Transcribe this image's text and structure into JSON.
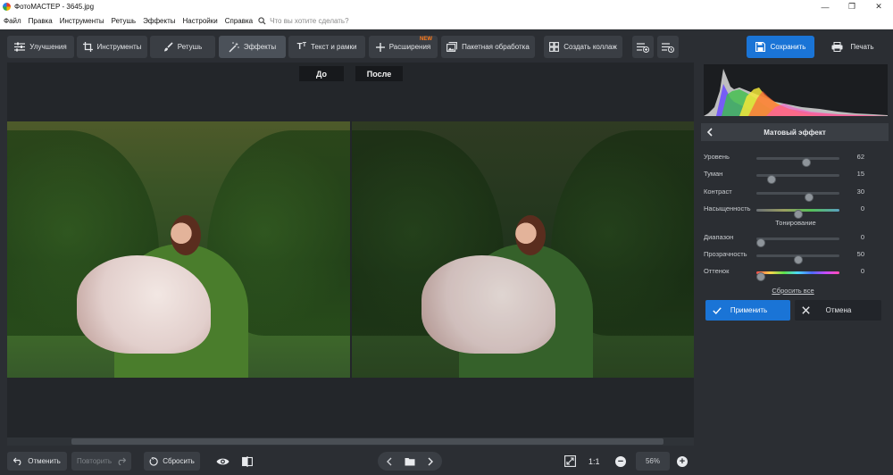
{
  "window": {
    "title": "ФотоМАСТЕР - 3645.jpg"
  },
  "menu": {
    "items": [
      "Файл",
      "Правка",
      "Инструменты",
      "Ретушь",
      "Эффекты",
      "Настройки",
      "Справка"
    ],
    "search_placeholder": "Что вы хотите сделать?"
  },
  "toolbar": {
    "tabs": [
      {
        "label": "Улучшения",
        "icon": "sliders-icon"
      },
      {
        "label": "Инструменты",
        "icon": "crop-icon"
      },
      {
        "label": "Ретушь",
        "icon": "brush-icon"
      },
      {
        "label": "Эффекты",
        "icon": "magic-wand-icon",
        "active": true
      },
      {
        "label": "Текст и рамки",
        "icon": "text-icon"
      },
      {
        "label": "Расширения",
        "icon": "plus-icon",
        "badge": "NEW"
      },
      {
        "label": "Пакетная обработка",
        "icon": "image-stack-icon"
      },
      {
        "label": "Создать коллаж",
        "icon": "collage-icon"
      }
    ],
    "save_label": "Сохранить",
    "print_label": "Печать"
  },
  "canvas": {
    "before_label": "До",
    "after_label": "После"
  },
  "bottom": {
    "undo_label": "Отменить",
    "redo_label": "Повторить",
    "reset_label": "Сбросить",
    "zoom_fit_label": "1:1",
    "zoom_value": "56%"
  },
  "panel": {
    "effect_title": "Матовый эффект",
    "params": [
      {
        "label": "Уровень",
        "value": "62",
        "fraction": 0.62
      },
      {
        "label": "Туман",
        "value": "15",
        "fraction": 0.15
      },
      {
        "label": "Контраст",
        "value": "30",
        "fraction": 0.65
      },
      {
        "label": "Насыщенность",
        "value": "0",
        "fraction": 0.5
      }
    ],
    "toning_title": "Тонирование",
    "toning_params": [
      {
        "label": "Диапазон",
        "value": "0",
        "fraction": 0.0
      },
      {
        "label": "Прозрачность",
        "value": "50",
        "fraction": 0.5
      },
      {
        "label": "Оттенок",
        "value": "0",
        "fraction": 0.0
      }
    ],
    "reset_all_label": "Сбросить все",
    "apply_label": "Применить",
    "cancel_label": "Отмена"
  },
  "colors": {
    "accent": "#1a74d6",
    "new_badge": "#ff7a1a",
    "background": "#2b2e33"
  }
}
